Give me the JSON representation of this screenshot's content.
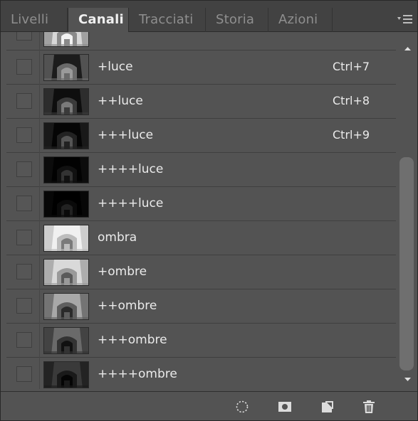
{
  "tabs": [
    {
      "label": "Livelli"
    },
    {
      "label": "Canali"
    },
    {
      "label": "Tracciati"
    },
    {
      "label": "Storia"
    },
    {
      "label": "Azioni"
    }
  ],
  "active_tab": "Canali",
  "channels": [
    {
      "name": "",
      "shortcut": "",
      "thumb": "bright"
    },
    {
      "name": "+luce",
      "shortcut": "Ctrl+7",
      "thumb": "dark1"
    },
    {
      "name": "++luce",
      "shortcut": "Ctrl+8",
      "thumb": "dark2"
    },
    {
      "name": "+++luce",
      "shortcut": "Ctrl+9",
      "thumb": "dark3"
    },
    {
      "name": "++++luce",
      "shortcut": "",
      "thumb": "dark4"
    },
    {
      "name": "++++luce",
      "shortcut": "",
      "thumb": "dark5"
    },
    {
      "name": "ombra",
      "shortcut": "",
      "thumb": "light1"
    },
    {
      "name": "+ombre",
      "shortcut": "",
      "thumb": "light2"
    },
    {
      "name": "++ombre",
      "shortcut": "",
      "thumb": "mid1"
    },
    {
      "name": "+++ombre",
      "shortcut": "",
      "thumb": "mid2"
    },
    {
      "name": "++++ombre",
      "shortcut": "",
      "thumb": "mid3"
    }
  ],
  "bottom_icons": [
    "load-selection-icon",
    "save-selection-icon",
    "new-channel-icon",
    "delete-channel-icon"
  ],
  "colors": {
    "panel": "#535353",
    "tabbar": "#424242",
    "text": "#eaeaea"
  }
}
